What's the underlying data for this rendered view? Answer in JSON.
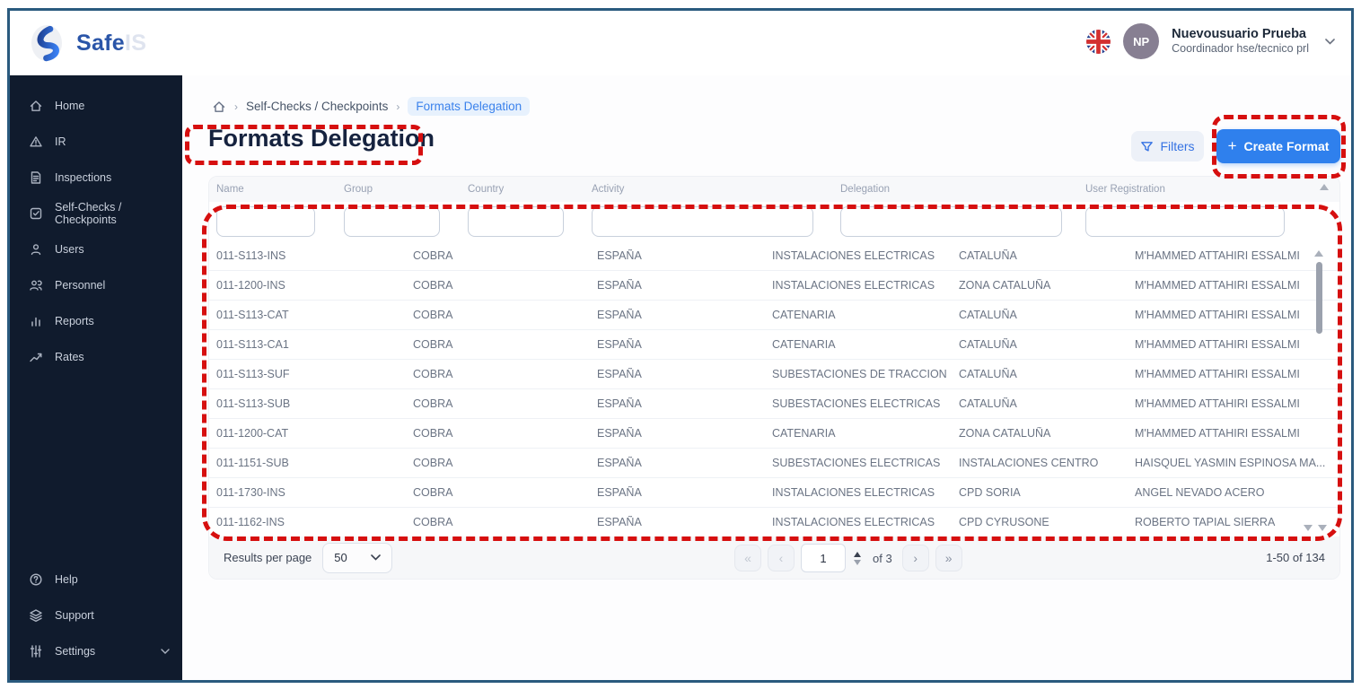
{
  "brand": {
    "primary": "Safe",
    "secondary": "IS"
  },
  "topbar": {
    "user_name": "Nuevousuario Prueba",
    "user_role": "Coordinador hse/tecnico prl",
    "avatar_initials": "NP"
  },
  "sidebar": {
    "items": [
      {
        "label": "Home"
      },
      {
        "label": "IR"
      },
      {
        "label": "Inspections"
      },
      {
        "label": "Self-Checks / Checkpoints"
      },
      {
        "label": "Users"
      },
      {
        "label": "Personnel"
      },
      {
        "label": "Reports"
      },
      {
        "label": "Rates"
      }
    ],
    "bottom_items": [
      {
        "label": "Help"
      },
      {
        "label": "Support"
      },
      {
        "label": "Settings"
      }
    ]
  },
  "breadcrumb": {
    "level1": "Self-Checks / Checkpoints",
    "level2": "Formats Delegation"
  },
  "page": {
    "title": "Formats Delegation"
  },
  "toolbar": {
    "filters_label": "Filters",
    "create_plus": "+",
    "create_format_label": "Create Format"
  },
  "table": {
    "columns": [
      "Name",
      "Group",
      "Country",
      "Activity",
      "Delegation",
      "User Registration"
    ],
    "rows": [
      [
        "011-S113-INS",
        "COBRA",
        "ESPAÑA",
        "INSTALACIONES ELECTRICAS",
        "CATALUÑA",
        "M'HAMMED ATTAHIRI ESSALMI"
      ],
      [
        "011-1200-INS",
        "COBRA",
        "ESPAÑA",
        "INSTALACIONES ELECTRICAS",
        "ZONA CATALUÑA",
        "M'HAMMED ATTAHIRI ESSALMI"
      ],
      [
        "011-S113-CAT",
        "COBRA",
        "ESPAÑA",
        "CATENARIA",
        "CATALUÑA",
        "M'HAMMED ATTAHIRI ESSALMI"
      ],
      [
        "011-S113-CA1",
        "COBRA",
        "ESPAÑA",
        "CATENARIA",
        "CATALUÑA",
        "M'HAMMED ATTAHIRI ESSALMI"
      ],
      [
        "011-S113-SUF",
        "COBRA",
        "ESPAÑA",
        "SUBESTACIONES DE TRACCION",
        "CATALUÑA",
        "M'HAMMED ATTAHIRI ESSALMI"
      ],
      [
        "011-S113-SUB",
        "COBRA",
        "ESPAÑA",
        "SUBESTACIONES ELECTRICAS",
        "CATALUÑA",
        "M'HAMMED ATTAHIRI ESSALMI"
      ],
      [
        "011-1200-CAT",
        "COBRA",
        "ESPAÑA",
        "CATENARIA",
        "ZONA CATALUÑA",
        "M'HAMMED ATTAHIRI ESSALMI"
      ],
      [
        "011-1151-SUB",
        "COBRA",
        "ESPAÑA",
        "SUBESTACIONES ELECTRICAS",
        "INSTALACIONES CENTRO",
        "HAISQUEL YASMIN ESPINOSA MA..."
      ],
      [
        "011-1730-INS",
        "COBRA",
        "ESPAÑA",
        "INSTALACIONES ELECTRICAS",
        "CPD SORIA",
        "ANGEL NEVADO ACERO"
      ],
      [
        "011-1162-INS",
        "COBRA",
        "ESPAÑA",
        "INSTALACIONES ELECTRICAS",
        "CPD CYRUSONE",
        "ROBERTO TAPIAL SIERRA"
      ]
    ]
  },
  "pagination": {
    "results_per_page_label": "Results per page",
    "page_size": "50",
    "first": "«",
    "prev": "‹",
    "next": "›",
    "last": "»",
    "current_page": "1",
    "of_label": "of 3",
    "range_label": "1-50 of 134"
  },
  "colors": {
    "accent_blue": "#2F80ED",
    "sidebar_bg": "#101B2D",
    "annotation_red": "#D60F0F"
  }
}
